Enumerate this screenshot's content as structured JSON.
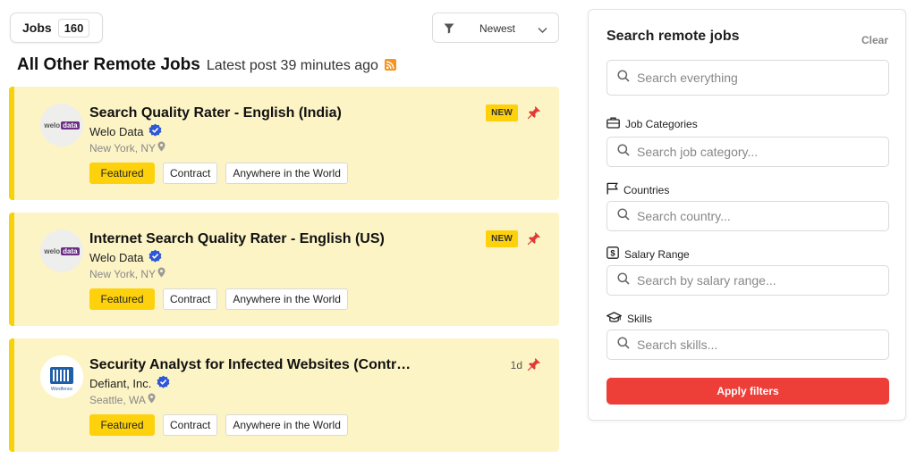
{
  "jobs_counter": {
    "label": "Jobs",
    "count": "160"
  },
  "sort": {
    "selected": "Newest"
  },
  "section": {
    "title": "All Other Remote Jobs",
    "subtitle": "Latest post 39 minutes ago"
  },
  "jobs": [
    {
      "title": "Search Quality Rater - English (India)",
      "company": "Welo Data",
      "location": "New York, NY",
      "logo_text": "welo",
      "logo_badge": "data",
      "badge": "NEW",
      "tags": [
        "Featured",
        "Contract",
        "Anywhere in the World"
      ]
    },
    {
      "title": "Internet Search Quality Rater - English (US)",
      "company": "Welo Data",
      "location": "New York, NY",
      "logo_text": "welo",
      "logo_badge": "data",
      "badge": "NEW",
      "tags": [
        "Featured",
        "Contract",
        "Anywhere in the World"
      ]
    },
    {
      "title": "Security Analyst for Infected Websites (Contr…",
      "company": "Defiant, Inc.",
      "location": "Seattle, WA",
      "logo_caption": "Wordfence",
      "age": "1d",
      "tags": [
        "Featured",
        "Contract",
        "Anywhere in the World"
      ]
    }
  ],
  "filters": {
    "title": "Search remote jobs",
    "clear_label": "Clear",
    "search_placeholder": "Search everything",
    "categories": {
      "label": "Job Categories",
      "placeholder": "Search job category..."
    },
    "countries": {
      "label": "Countries",
      "placeholder": "Search country..."
    },
    "salary": {
      "label": "Salary Range",
      "placeholder": "Search by salary range..."
    },
    "skills": {
      "label": "Skills",
      "placeholder": "Search skills..."
    },
    "apply_label": "Apply filters"
  },
  "colors": {
    "card_bg": "#fdf4c6",
    "card_accent": "#f6d20a",
    "featured_tag": "#fdd10b",
    "apply_button": "#ee3e38",
    "verified": "#2d57d6",
    "pin": "#e23a36",
    "rss": "#f7931e"
  },
  "icons": [
    "filter-icon",
    "chevron-down-icon",
    "rss-icon",
    "verified-icon",
    "location-pin-icon",
    "pin-icon",
    "search-icon",
    "briefcase-icon",
    "flag-icon",
    "dollar-icon",
    "graduation-cap-icon"
  ]
}
